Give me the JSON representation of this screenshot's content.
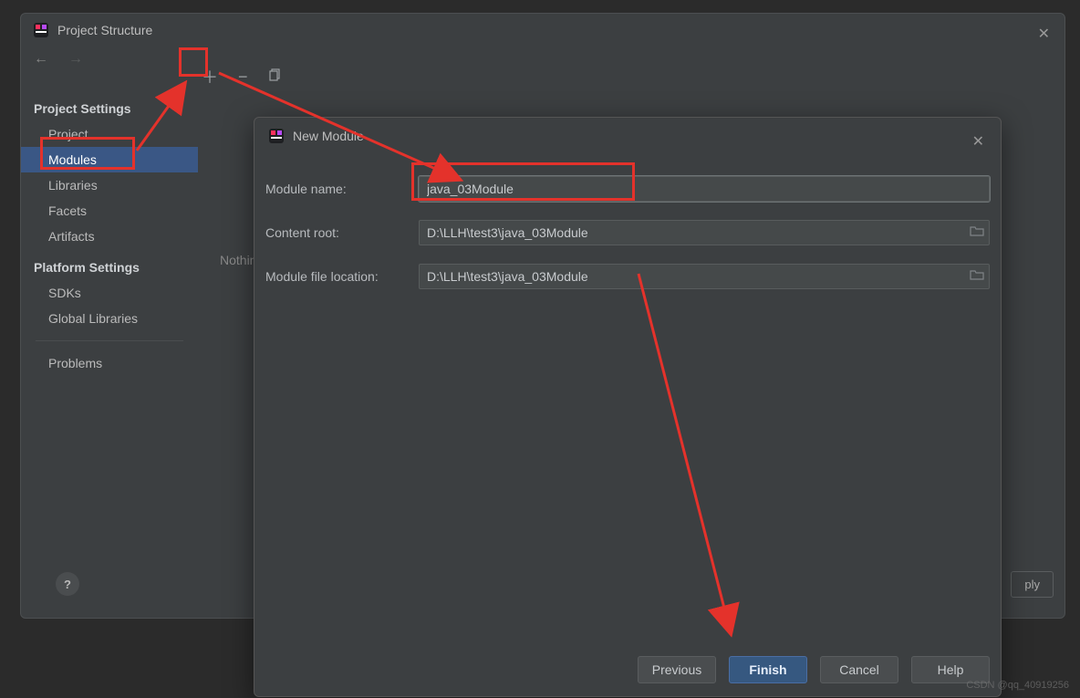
{
  "ps": {
    "title": "Project Structure",
    "placeholder_text": "Nothin",
    "apply_label": "ply",
    "headings": {
      "project_settings": "Project Settings",
      "platform_settings": "Platform Settings"
    },
    "items": {
      "project": "Project",
      "modules": "Modules",
      "libraries": "Libraries",
      "facets": "Facets",
      "artifacts": "Artifacts",
      "sdks": "SDKs",
      "global_libraries": "Global Libraries",
      "problems": "Problems"
    }
  },
  "nm": {
    "title": "New Module",
    "labels": {
      "module_name": "Module name:",
      "content_root": "Content root:",
      "module_file_location": "Module file location:"
    },
    "values": {
      "module_name": "java_03Module",
      "content_root": "D:\\LLH\\test3\\java_03Module",
      "module_file_location": "D:\\LLH\\test3\\java_03Module"
    },
    "buttons": {
      "previous": "Previous",
      "finish": "Finish",
      "cancel": "Cancel",
      "help": "Help"
    }
  },
  "watermark": "CSDN @qq_40919256",
  "help_symbol": "?"
}
